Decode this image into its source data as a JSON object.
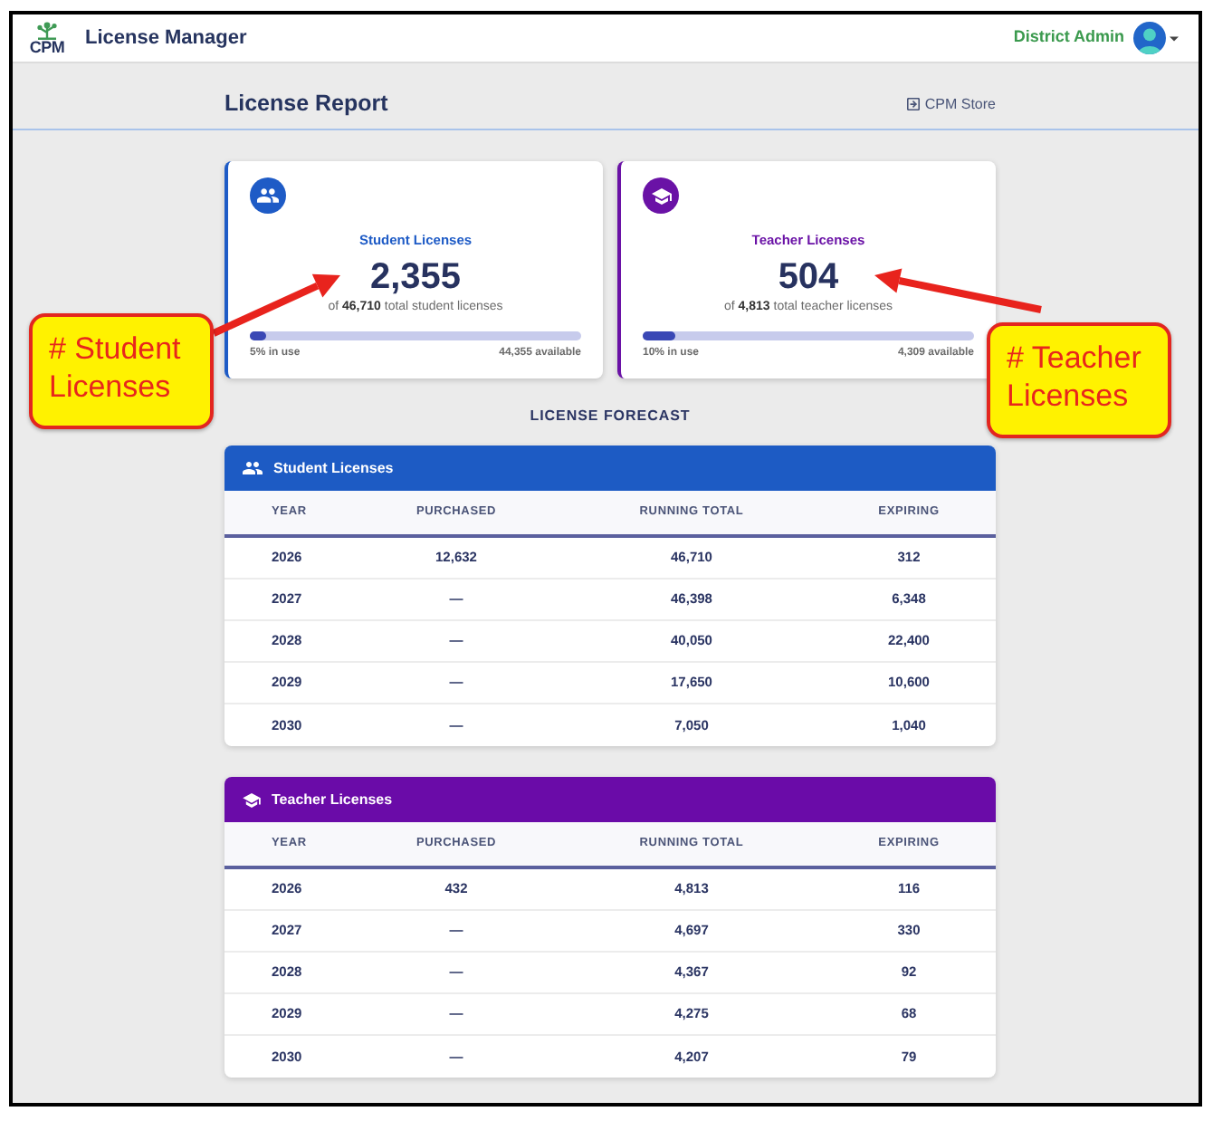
{
  "header": {
    "logo_text": "CPM",
    "app_title": "License Manager",
    "user_name": "District Admin"
  },
  "report_bar": {
    "title": "License Report",
    "store_link": "CPM Store"
  },
  "cards": [
    {
      "kind": "student",
      "color": "#1e5bc6",
      "title": "Student Licenses",
      "count": "2,355",
      "total_text": "of **46,710** total student licenses",
      "level": 0.05,
      "in_use": "5% in use",
      "available": "44,355 available"
    },
    {
      "kind": "teacher",
      "color": "#6a12a6",
      "title": "Teacher Licenses",
      "count": "504",
      "total_text": "of **4,813** total teacher licenses",
      "level": 0.1,
      "in_use": "10% in use",
      "available": "4,309 available"
    }
  ],
  "forecast": {
    "title": "LICENSE FORECAST",
    "tables": [
      {
        "kind": "student",
        "color": "#1d5bc4",
        "title": "Student Licenses",
        "columns": [
          "YEAR",
          "PURCHASED",
          "RUNNING TOTAL",
          "EXPIRING"
        ],
        "rows": [
          [
            "2026",
            "12,632",
            "46,710",
            "312"
          ],
          [
            "2027",
            "—",
            "46,398",
            "6,348"
          ],
          [
            "2028",
            "—",
            "40,050",
            "22,400"
          ],
          [
            "2029",
            "—",
            "17,650",
            "10,600"
          ],
          [
            "2030",
            "—",
            "7,050",
            "1,040"
          ]
        ]
      },
      {
        "kind": "teacher",
        "color": "#6a0ba8",
        "title": "Teacher Licenses",
        "columns": [
          "YEAR",
          "PURCHASED",
          "RUNNING TOTAL",
          "EXPIRING"
        ],
        "rows": [
          [
            "2026",
            "432",
            "4,813",
            "116"
          ],
          [
            "2027",
            "—",
            "4,697",
            "330"
          ],
          [
            "2028",
            "—",
            "4,367",
            "92"
          ],
          [
            "2029",
            "—",
            "4,275",
            "68"
          ],
          [
            "2030",
            "—",
            "4,207",
            "79"
          ]
        ]
      }
    ]
  },
  "annotations": [
    {
      "text": "# Student Licenses"
    },
    {
      "text": "# Teacher Licenses"
    }
  ]
}
